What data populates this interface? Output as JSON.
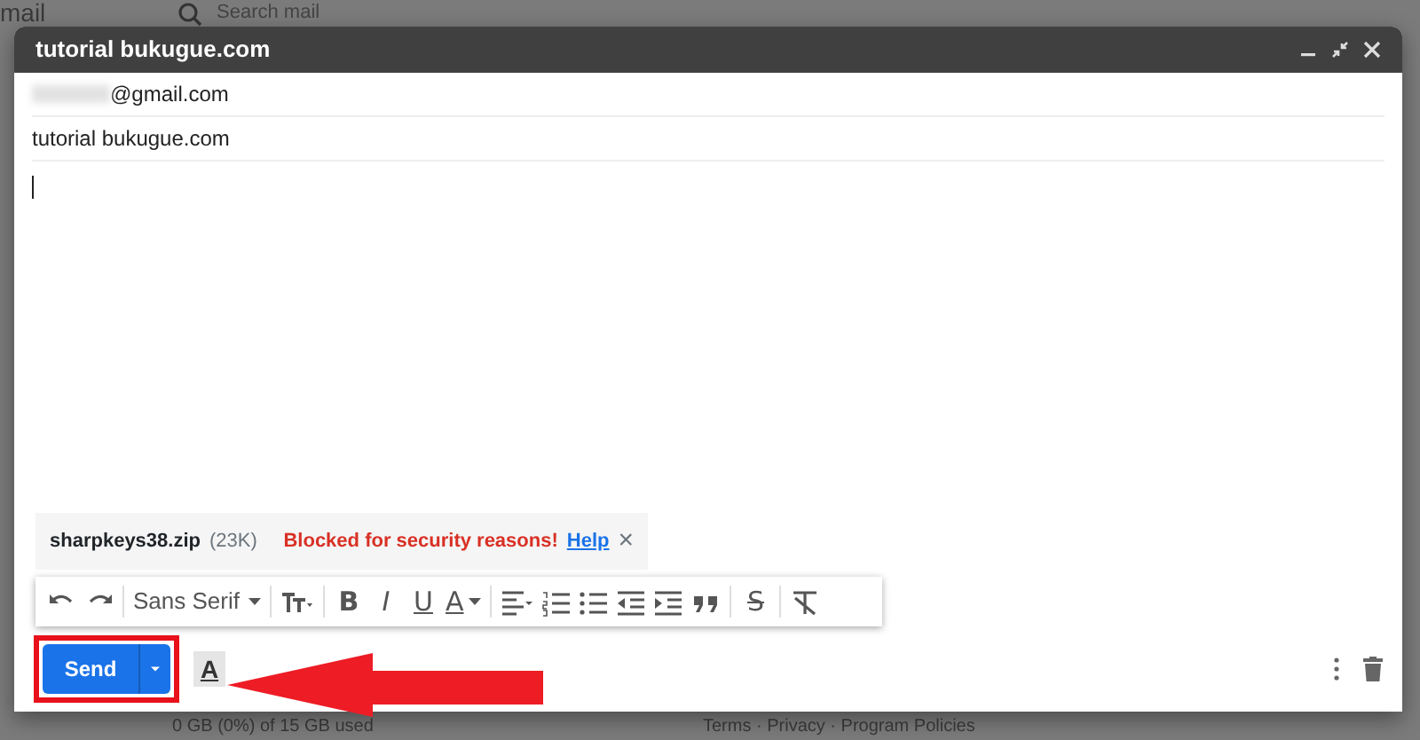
{
  "background": {
    "corner_text": "mail",
    "search_placeholder": "Search mail",
    "storage": "0 GB (0%) of 15 GB used",
    "footer_links": "Terms · Privacy · Program Policies"
  },
  "compose": {
    "title": "tutorial bukugue.com",
    "recipient": "@gmail.com",
    "subject": "tutorial bukugue.com",
    "attachment": {
      "name": "sharpkeys38.zip",
      "size": "(23K)",
      "warning": "Blocked for security reasons!",
      "help": "Help",
      "remove": "×"
    },
    "toolbar": [
      {
        "kind": "undo"
      },
      {
        "kind": "redo"
      },
      {
        "kind": "sep"
      },
      {
        "kind": "font",
        "label": "Sans Serif"
      },
      {
        "kind": "sep"
      },
      {
        "kind": "size"
      },
      {
        "kind": "sep"
      },
      {
        "kind": "bold",
        "label": "B"
      },
      {
        "kind": "italic",
        "label": "I"
      },
      {
        "kind": "underline",
        "label": "U"
      },
      {
        "kind": "color",
        "label": "A"
      },
      {
        "kind": "sep"
      },
      {
        "kind": "align"
      },
      {
        "kind": "numbered"
      },
      {
        "kind": "bulleted"
      },
      {
        "kind": "outdent"
      },
      {
        "kind": "indent"
      },
      {
        "kind": "quote"
      },
      {
        "kind": "sep"
      },
      {
        "kind": "strike",
        "label": "S"
      },
      {
        "kind": "sep"
      },
      {
        "kind": "clear"
      }
    ],
    "send": "Send",
    "format_label": "A"
  }
}
